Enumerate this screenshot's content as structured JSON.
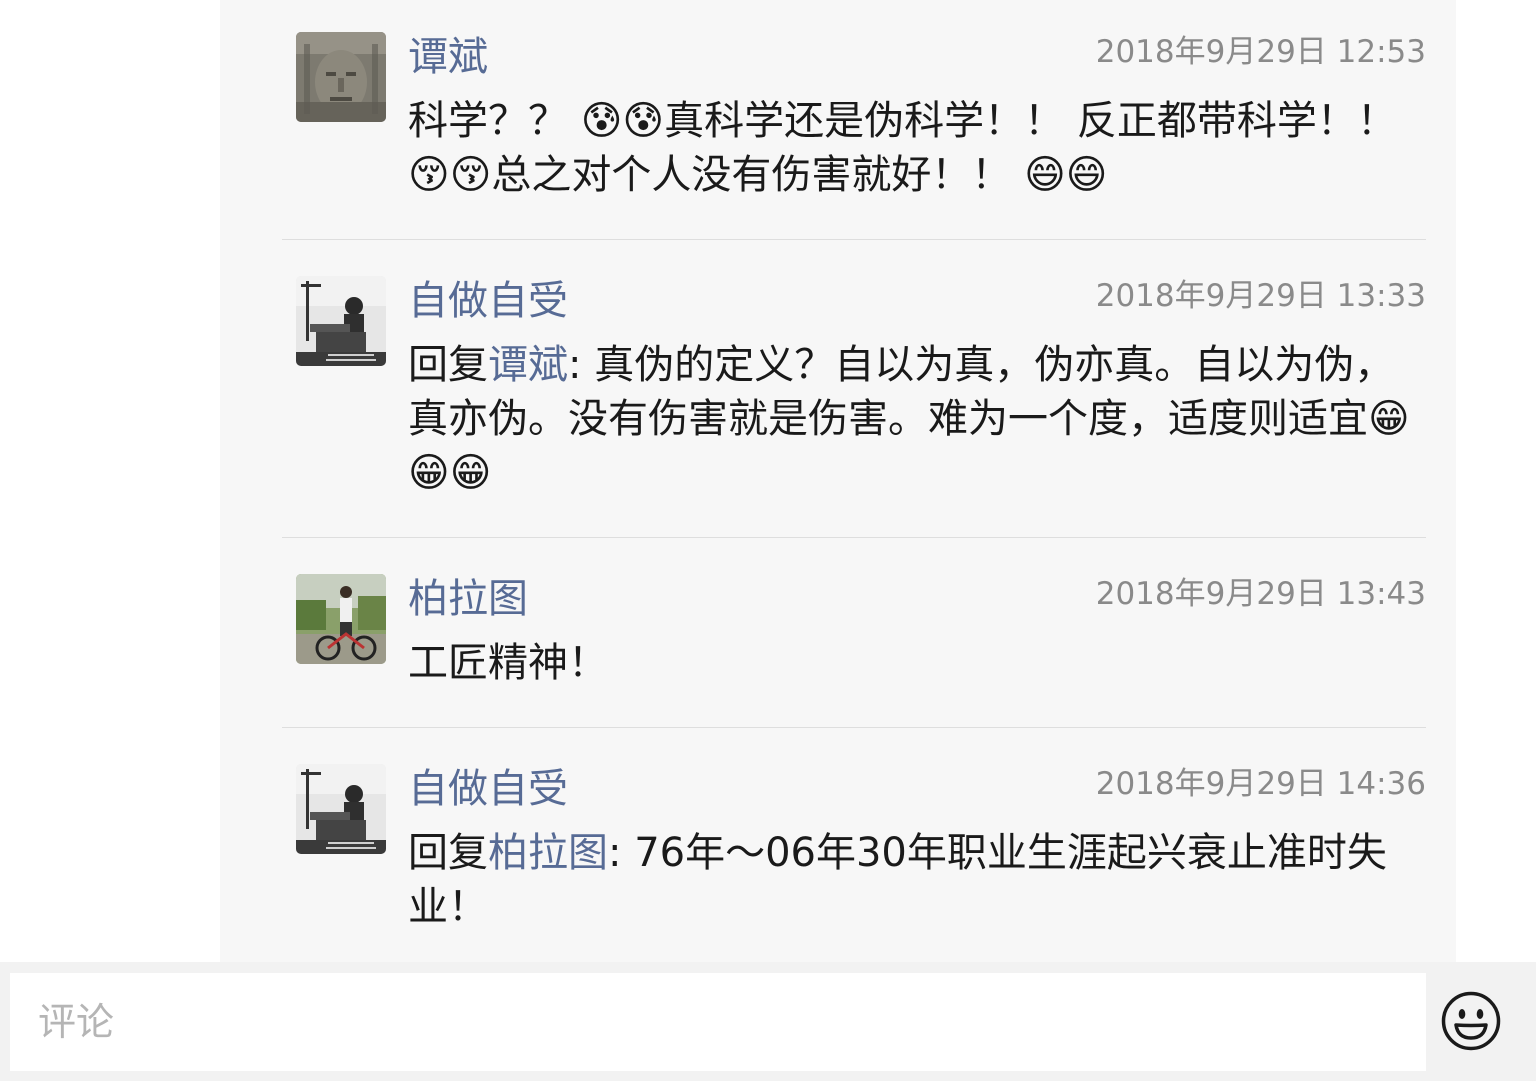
{
  "comments": [
    {
      "author": "谭斌",
      "timestamp": "2018年9月29日 12:53",
      "text": "科学？？ 😰😰真科学还是伪科学！！ 反正都带科学！！ 😚😚总之对个人没有伤害就好！！ 😄😄",
      "avatar_icon": "stone-face-avatar"
    },
    {
      "author": "自做自受",
      "timestamp": "2018年9月29日 13:33",
      "reply_prefix": "回复",
      "reply_to": "谭斌",
      "text": ": 真伪的定义？自以为真，伪亦真。自以为伪，真亦伪。没有伤害就是伤害。难为一个度，适度则适宜😁😁😁",
      "avatar_icon": "workshop-photo-avatar"
    },
    {
      "author": "柏拉图",
      "timestamp": "2018年9月29日 13:43",
      "text": "工匠精神！",
      "avatar_icon": "cyclist-photo-avatar"
    },
    {
      "author": "自做自受",
      "timestamp": "2018年9月29日 14:36",
      "reply_prefix": "回复",
      "reply_to": "柏拉图",
      "text": ": 76年～06年30年职业生涯起兴衰止准时失业！",
      "avatar_icon": "workshop-photo-avatar"
    }
  ],
  "input": {
    "placeholder": "评论"
  },
  "emoji_button_icon": "smiley-face-icon",
  "colors": {
    "author_link": "#576b95",
    "timestamp": "#8a8a8a",
    "panel_bg": "#f7f7f7",
    "divider": "#dedede"
  }
}
